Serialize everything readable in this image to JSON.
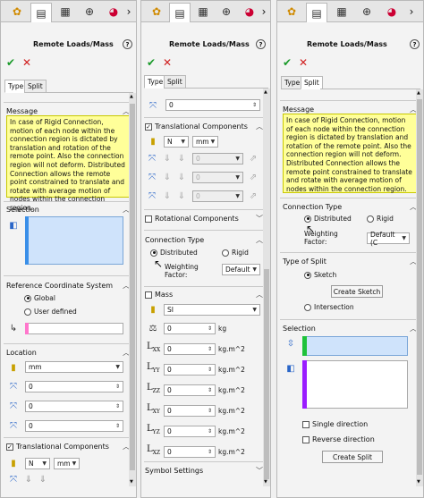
{
  "title": "Remote Loads/Mass",
  "help": "?",
  "tabs": {
    "type": "Type",
    "split": "Split"
  },
  "message": {
    "header": "Message",
    "text": "In case of Rigid Connection, motion of each node within the connection region is dictated by translation and rotation of the remote point. Also the connection region will not deform. Distributed Connection allows the remote point constrained to translate and rotate with average motion of nodes within the connection region."
  },
  "p1": {
    "selection_header": "Selection",
    "rcs": {
      "header": "Reference Coordinate System",
      "global": "Global",
      "user_defined": "User defined"
    },
    "location": {
      "header": "Location",
      "unit": "mm",
      "v1": "0",
      "v2": "0",
      "v3": "0",
      "v4": "0"
    },
    "trans": {
      "header": "Translational Components",
      "unit1": "N",
      "unit2": "mm"
    }
  },
  "p2": {
    "top_value": "0",
    "trans": {
      "header": "Translational Components",
      "unit1": "N",
      "unit2": "mm",
      "v1": "0",
      "v2": "0",
      "v3": "0"
    },
    "rot_header": "Rotational Components",
    "conn": {
      "header": "Connection Type",
      "distributed": "Distributed",
      "rigid": "Rigid",
      "weighting_label": "Weighting Factor:",
      "weighting_value": "Default"
    },
    "mass": {
      "header": "Mass",
      "system": "SI",
      "rows": [
        {
          "value": "0",
          "unit": "kg"
        },
        {
          "value": "0",
          "unit": "kg.m^2"
        },
        {
          "value": "0",
          "unit": "kg.m^2"
        },
        {
          "value": "0",
          "unit": "kg.m^2"
        },
        {
          "value": "0",
          "unit": "kg.m^2"
        },
        {
          "value": "0",
          "unit": "kg.m^2"
        },
        {
          "value": "0",
          "unit": "kg.m^2"
        }
      ]
    },
    "symbol_header": "Symbol Settings"
  },
  "p3": {
    "conn": {
      "header": "Connection Type",
      "distributed": "Distributed",
      "rigid": "Rigid",
      "weighting_label": "Weighting Factor:",
      "weighting_value": "Default (C"
    },
    "split": {
      "header": "Type of Split",
      "sketch": "Sketch",
      "create_sketch": "Create Sketch",
      "intersection": "Intersection"
    },
    "selection": {
      "header": "Selection",
      "single": "Single direction",
      "reverse": "Reverse direction",
      "create_split": "Create Split"
    }
  },
  "colors": {
    "accent_green": "#1ec23a",
    "accent_purple": "#9a1cff",
    "message_bg": "#ffff99"
  }
}
